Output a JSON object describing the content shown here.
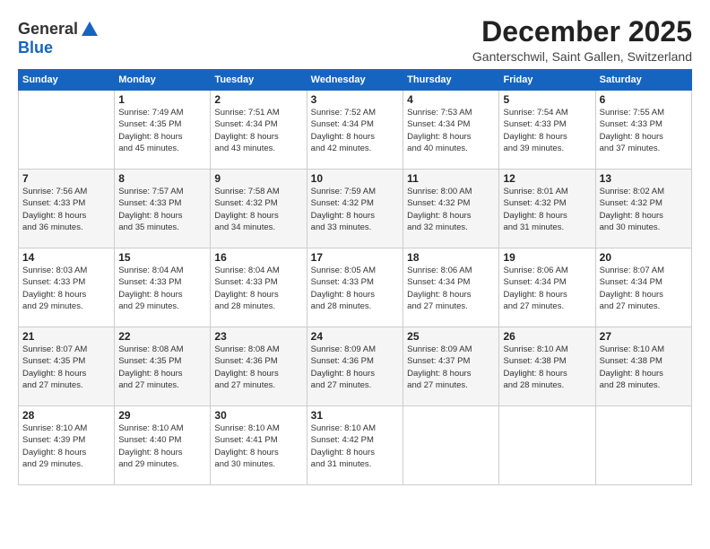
{
  "logo": {
    "general": "General",
    "blue": "Blue"
  },
  "header": {
    "month": "December 2025",
    "location": "Ganterschwil, Saint Gallen, Switzerland"
  },
  "weekdays": [
    "Sunday",
    "Monday",
    "Tuesday",
    "Wednesday",
    "Thursday",
    "Friday",
    "Saturday"
  ],
  "weeks": [
    [
      {
        "day": "",
        "info": ""
      },
      {
        "day": "1",
        "info": "Sunrise: 7:49 AM\nSunset: 4:35 PM\nDaylight: 8 hours\nand 45 minutes."
      },
      {
        "day": "2",
        "info": "Sunrise: 7:51 AM\nSunset: 4:34 PM\nDaylight: 8 hours\nand 43 minutes."
      },
      {
        "day": "3",
        "info": "Sunrise: 7:52 AM\nSunset: 4:34 PM\nDaylight: 8 hours\nand 42 minutes."
      },
      {
        "day": "4",
        "info": "Sunrise: 7:53 AM\nSunset: 4:34 PM\nDaylight: 8 hours\nand 40 minutes."
      },
      {
        "day": "5",
        "info": "Sunrise: 7:54 AM\nSunset: 4:33 PM\nDaylight: 8 hours\nand 39 minutes."
      },
      {
        "day": "6",
        "info": "Sunrise: 7:55 AM\nSunset: 4:33 PM\nDaylight: 8 hours\nand 37 minutes."
      }
    ],
    [
      {
        "day": "7",
        "info": "Sunrise: 7:56 AM\nSunset: 4:33 PM\nDaylight: 8 hours\nand 36 minutes."
      },
      {
        "day": "8",
        "info": "Sunrise: 7:57 AM\nSunset: 4:33 PM\nDaylight: 8 hours\nand 35 minutes."
      },
      {
        "day": "9",
        "info": "Sunrise: 7:58 AM\nSunset: 4:32 PM\nDaylight: 8 hours\nand 34 minutes."
      },
      {
        "day": "10",
        "info": "Sunrise: 7:59 AM\nSunset: 4:32 PM\nDaylight: 8 hours\nand 33 minutes."
      },
      {
        "day": "11",
        "info": "Sunrise: 8:00 AM\nSunset: 4:32 PM\nDaylight: 8 hours\nand 32 minutes."
      },
      {
        "day": "12",
        "info": "Sunrise: 8:01 AM\nSunset: 4:32 PM\nDaylight: 8 hours\nand 31 minutes."
      },
      {
        "day": "13",
        "info": "Sunrise: 8:02 AM\nSunset: 4:32 PM\nDaylight: 8 hours\nand 30 minutes."
      }
    ],
    [
      {
        "day": "14",
        "info": "Sunrise: 8:03 AM\nSunset: 4:33 PM\nDaylight: 8 hours\nand 29 minutes."
      },
      {
        "day": "15",
        "info": "Sunrise: 8:04 AM\nSunset: 4:33 PM\nDaylight: 8 hours\nand 29 minutes."
      },
      {
        "day": "16",
        "info": "Sunrise: 8:04 AM\nSunset: 4:33 PM\nDaylight: 8 hours\nand 28 minutes."
      },
      {
        "day": "17",
        "info": "Sunrise: 8:05 AM\nSunset: 4:33 PM\nDaylight: 8 hours\nand 28 minutes."
      },
      {
        "day": "18",
        "info": "Sunrise: 8:06 AM\nSunset: 4:34 PM\nDaylight: 8 hours\nand 27 minutes."
      },
      {
        "day": "19",
        "info": "Sunrise: 8:06 AM\nSunset: 4:34 PM\nDaylight: 8 hours\nand 27 minutes."
      },
      {
        "day": "20",
        "info": "Sunrise: 8:07 AM\nSunset: 4:34 PM\nDaylight: 8 hours\nand 27 minutes."
      }
    ],
    [
      {
        "day": "21",
        "info": "Sunrise: 8:07 AM\nSunset: 4:35 PM\nDaylight: 8 hours\nand 27 minutes."
      },
      {
        "day": "22",
        "info": "Sunrise: 8:08 AM\nSunset: 4:35 PM\nDaylight: 8 hours\nand 27 minutes."
      },
      {
        "day": "23",
        "info": "Sunrise: 8:08 AM\nSunset: 4:36 PM\nDaylight: 8 hours\nand 27 minutes."
      },
      {
        "day": "24",
        "info": "Sunrise: 8:09 AM\nSunset: 4:36 PM\nDaylight: 8 hours\nand 27 minutes."
      },
      {
        "day": "25",
        "info": "Sunrise: 8:09 AM\nSunset: 4:37 PM\nDaylight: 8 hours\nand 27 minutes."
      },
      {
        "day": "26",
        "info": "Sunrise: 8:10 AM\nSunset: 4:38 PM\nDaylight: 8 hours\nand 28 minutes."
      },
      {
        "day": "27",
        "info": "Sunrise: 8:10 AM\nSunset: 4:38 PM\nDaylight: 8 hours\nand 28 minutes."
      }
    ],
    [
      {
        "day": "28",
        "info": "Sunrise: 8:10 AM\nSunset: 4:39 PM\nDaylight: 8 hours\nand 29 minutes."
      },
      {
        "day": "29",
        "info": "Sunrise: 8:10 AM\nSunset: 4:40 PM\nDaylight: 8 hours\nand 29 minutes."
      },
      {
        "day": "30",
        "info": "Sunrise: 8:10 AM\nSunset: 4:41 PM\nDaylight: 8 hours\nand 30 minutes."
      },
      {
        "day": "31",
        "info": "Sunrise: 8:10 AM\nSunset: 4:42 PM\nDaylight: 8 hours\nand 31 minutes."
      },
      {
        "day": "",
        "info": ""
      },
      {
        "day": "",
        "info": ""
      },
      {
        "day": "",
        "info": ""
      }
    ]
  ]
}
